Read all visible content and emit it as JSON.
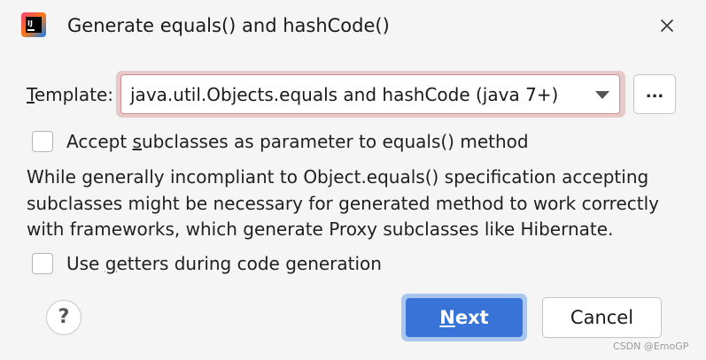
{
  "window": {
    "title": "Generate equals() and hashCode()",
    "app_icon": "intellij-idea-icon",
    "close_icon": "close-icon"
  },
  "template": {
    "label_mnemonic": "T",
    "label_rest": "emplate:",
    "selected_value": "java.util.Objects.equals and hashCode (java 7+)",
    "dropdown_icon": "chevron-down-icon",
    "browse_label": "..."
  },
  "options": {
    "accept_subclasses": {
      "label_before": "Accept ",
      "label_mnemonic": "s",
      "label_after": "ubclasses as parameter to equals() method",
      "checked": false
    },
    "use_getters": {
      "label_before": "Use ",
      "label_mnemonic": "g",
      "label_after": "etters during code generation",
      "checked": false
    }
  },
  "description": {
    "line1": "While generally incompliant to Object.equals() specification accepting",
    "line2": "subclasses might be necessary for generated method to work correctly",
    "line3": "with frameworks, which generate Proxy subclasses like Hibernate."
  },
  "footer": {
    "help_label": "?",
    "next_mnemonic": "N",
    "next_rest": "ext",
    "cancel_label": "Cancel"
  },
  "watermark": "CSDN @EmoGP",
  "colors": {
    "primary_button": "#3874d8",
    "error_outline": "#d08f8f",
    "background": "#f5f5f5"
  }
}
